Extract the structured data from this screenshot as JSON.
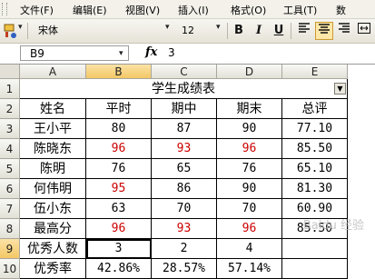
{
  "menu": [
    "文件(F)",
    "编辑(E)",
    "视图(V)",
    "插入(I)",
    "格式(O)",
    "工具(T)",
    "数"
  ],
  "toolbar": {
    "font": "宋体",
    "size": "12",
    "bold": "B",
    "italic": "I",
    "underline": "U"
  },
  "formula_bar": {
    "name_box": "B9",
    "fx": "fx",
    "value": "3"
  },
  "columns": [
    "A",
    "B",
    "C",
    "D",
    "E"
  ],
  "rows": [
    "1",
    "2",
    "3",
    "4",
    "5",
    "6",
    "7",
    "8",
    "9",
    "10"
  ],
  "sheet": {
    "title": "学生成绩表",
    "headers": [
      "姓名",
      "平时",
      "期中",
      "期末",
      "总评"
    ],
    "data": [
      [
        "王小平",
        "80",
        "87",
        "90",
        "77.10"
      ],
      [
        "陈晓东",
        "96",
        "93",
        "96",
        "85.50"
      ],
      [
        "陈明",
        "76",
        "65",
        "76",
        "65.10"
      ],
      [
        "何伟明",
        "95",
        "86",
        "90",
        "81.30"
      ],
      [
        "伍小东",
        "63",
        "70",
        "70",
        "60.90"
      ],
      [
        "最高分",
        "96",
        "93",
        "96",
        "85.50"
      ],
      [
        "优秀人数",
        "3",
        "2",
        "4",
        ""
      ],
      [
        "优秀率",
        "42.86%",
        "28.57%",
        "57.14%",
        ""
      ]
    ],
    "red_cells": [
      [
        1,
        1
      ],
      [
        1,
        2
      ],
      [
        1,
        3
      ],
      [
        3,
        1
      ],
      [
        5,
        1
      ],
      [
        5,
        2
      ],
      [
        5,
        3
      ]
    ]
  },
  "colors": {
    "accent": "#f3c866",
    "red_text": "#cc0000"
  }
}
